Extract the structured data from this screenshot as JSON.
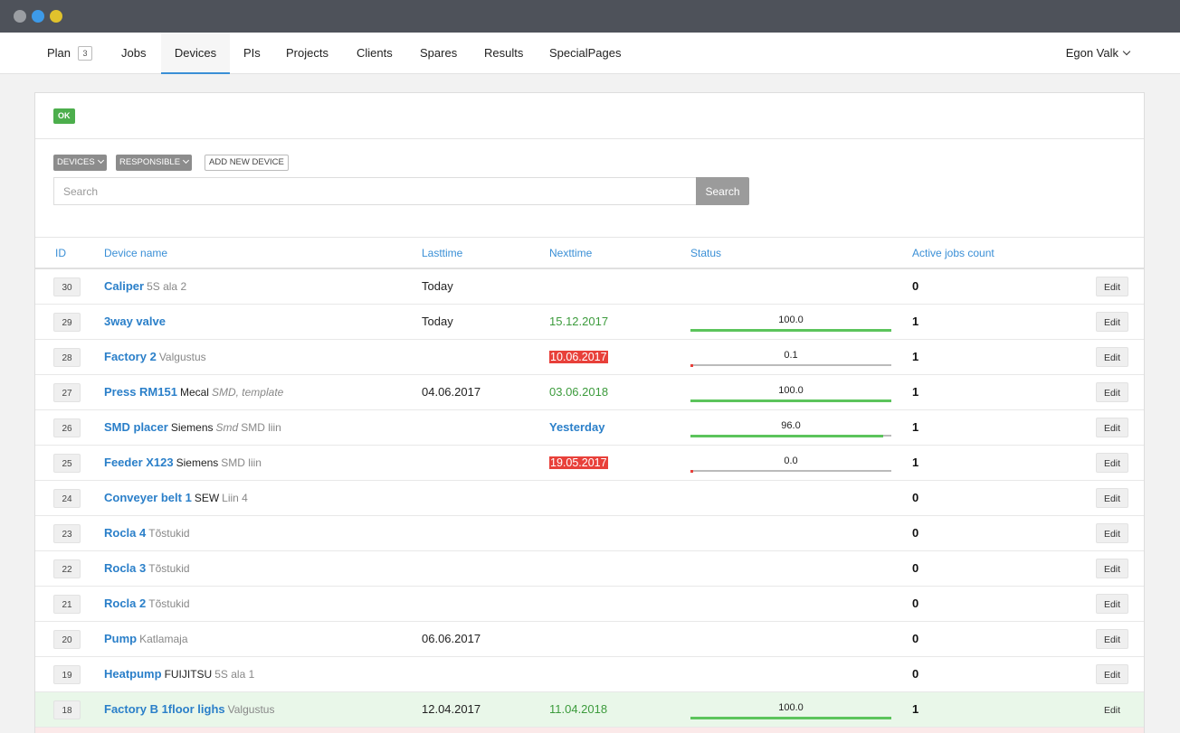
{
  "colors": {
    "accent": "#3a8fd6",
    "ok": "#4cae4c",
    "danger": "#e8403a",
    "progress": "#5cc45c"
  },
  "nav": {
    "items": [
      {
        "label": "Plan",
        "count": "3"
      },
      {
        "label": "Jobs"
      },
      {
        "label": "Devices",
        "active": true
      },
      {
        "label": "PIs"
      },
      {
        "label": "Projects"
      },
      {
        "label": "Clients"
      },
      {
        "label": "Spares"
      },
      {
        "label": "Results"
      },
      {
        "label": "SpecialPages"
      }
    ],
    "user": "Egon Valk"
  },
  "alert": {
    "label": "OK"
  },
  "toolbar": {
    "devices_label": "DEVICES",
    "responsible_label": "RESPONSIBLE",
    "add_label": "ADD NEW DEVICE",
    "search_placeholder": "Search",
    "search_button": "Search"
  },
  "table": {
    "headers": {
      "id": "ID",
      "name": "Device name",
      "lasttime": "Lasttime",
      "nexttime": "Nexttime",
      "status": "Status",
      "jobs": "Active jobs count"
    },
    "edit_label": "Edit",
    "rows": [
      {
        "id": "30",
        "name": "Caliper",
        "brand": "",
        "tags": "",
        "location": "5S ala 2",
        "lasttime": "Today",
        "nexttime": "",
        "nexttime_style": "",
        "status": "",
        "jobs": "0"
      },
      {
        "id": "29",
        "name": "3way valve",
        "brand": "",
        "tags": "",
        "location": "",
        "lasttime": "Today",
        "nexttime": "15.12.2017",
        "nexttime_style": "green",
        "status": "100.0",
        "jobs": "1"
      },
      {
        "id": "28",
        "name": "Factory 2",
        "brand": "",
        "tags": "",
        "location": "Valgustus",
        "lasttime": "",
        "nexttime": "10.06.2017",
        "nexttime_style": "red",
        "status": "0.1",
        "jobs": "1"
      },
      {
        "id": "27",
        "name": "Press RM151",
        "brand": "Mecal",
        "tags": "SMD, template",
        "location": "",
        "lasttime": "04.06.2017",
        "nexttime": "03.06.2018",
        "nexttime_style": "green",
        "status": "100.0",
        "jobs": "1"
      },
      {
        "id": "26",
        "name": "SMD placer",
        "brand": "Siemens",
        "tags": "Smd",
        "location": "SMD liin",
        "lasttime": "",
        "nexttime": "Yesterday",
        "nexttime_style": "blue",
        "status": "96.0",
        "jobs": "1"
      },
      {
        "id": "25",
        "name": "Feeder X123",
        "brand": "Siemens",
        "tags": "",
        "location": "SMD liin",
        "lasttime": "",
        "nexttime": "19.05.2017",
        "nexttime_style": "red",
        "status": "0.0",
        "jobs": "1"
      },
      {
        "id": "24",
        "name": "Conveyer belt 1",
        "brand": "SEW",
        "tags": "",
        "location": "Liin 4",
        "lasttime": "",
        "nexttime": "",
        "nexttime_style": "",
        "status": "",
        "jobs": "0"
      },
      {
        "id": "23",
        "name": "Rocla 4",
        "brand": "",
        "tags": "",
        "location": "Tõstukid",
        "lasttime": "",
        "nexttime": "",
        "nexttime_style": "",
        "status": "",
        "jobs": "0"
      },
      {
        "id": "22",
        "name": "Rocla 3",
        "brand": "",
        "tags": "",
        "location": "Tõstukid",
        "lasttime": "",
        "nexttime": "",
        "nexttime_style": "",
        "status": "",
        "jobs": "0"
      },
      {
        "id": "21",
        "name": "Rocla 2",
        "brand": "",
        "tags": "",
        "location": "Tõstukid",
        "lasttime": "",
        "nexttime": "",
        "nexttime_style": "",
        "status": "",
        "jobs": "0"
      },
      {
        "id": "20",
        "name": "Pump",
        "brand": "",
        "tags": "",
        "location": "Katlamaja",
        "lasttime": "06.06.2017",
        "nexttime": "",
        "nexttime_style": "",
        "status": "",
        "jobs": "0"
      },
      {
        "id": "19",
        "name": "Heatpump",
        "brand": "FUIJITSU",
        "tags": "",
        "location": "5S ala 1",
        "lasttime": "",
        "nexttime": "",
        "nexttime_style": "",
        "status": "",
        "jobs": "0"
      },
      {
        "id": "18",
        "name": "Factory B 1floor lighs",
        "brand": "",
        "tags": "",
        "location": "Valgustus",
        "lasttime": "12.04.2017",
        "nexttime": "11.04.2018",
        "nexttime_style": "green",
        "status": "100.0",
        "jobs": "1",
        "highlight": true
      }
    ]
  }
}
